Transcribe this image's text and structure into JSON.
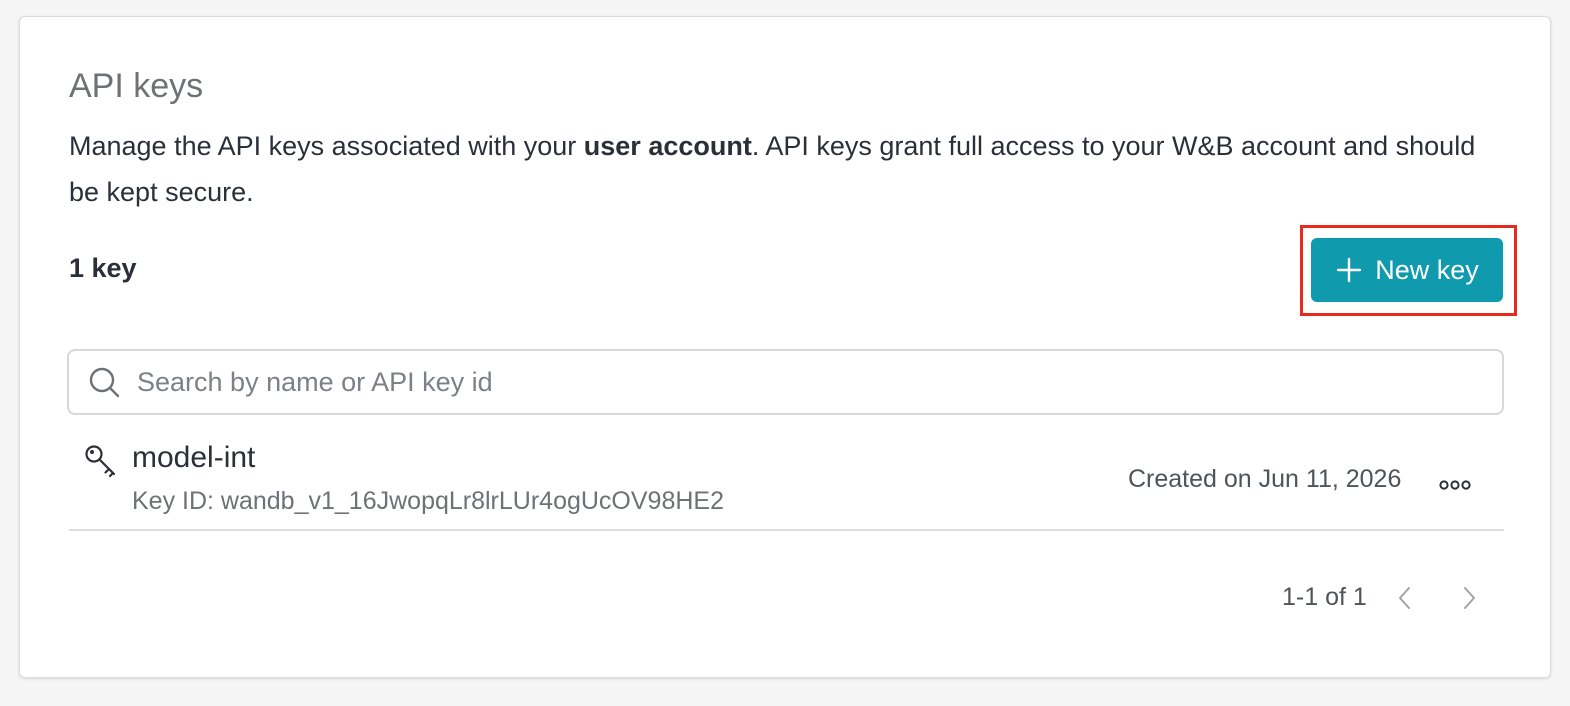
{
  "section": {
    "title": "API keys",
    "description_before": "Manage the API keys associated with your ",
    "description_bold": "user account",
    "description_after": ". API keys grant full access to your W&B account and should be kept secure."
  },
  "keys_count_label": "1 key",
  "new_key_button": {
    "label": "New key",
    "icon": "plus-icon"
  },
  "search": {
    "placeholder": "Search by name or API key id",
    "value": ""
  },
  "keys": [
    {
      "name": "model-int",
      "key_id": "Key ID: wandb_v1_16JwopqLr8lrLUr4ogUcOV98HE2",
      "created": "Created on Jun 11, 2026",
      "icon": "key-icon",
      "menu_icon": "more-options-icon"
    }
  ],
  "pagination": {
    "label": "1-1 of 1"
  },
  "colors": {
    "accent": "#0f9aad",
    "highlight": "#e8291c"
  }
}
